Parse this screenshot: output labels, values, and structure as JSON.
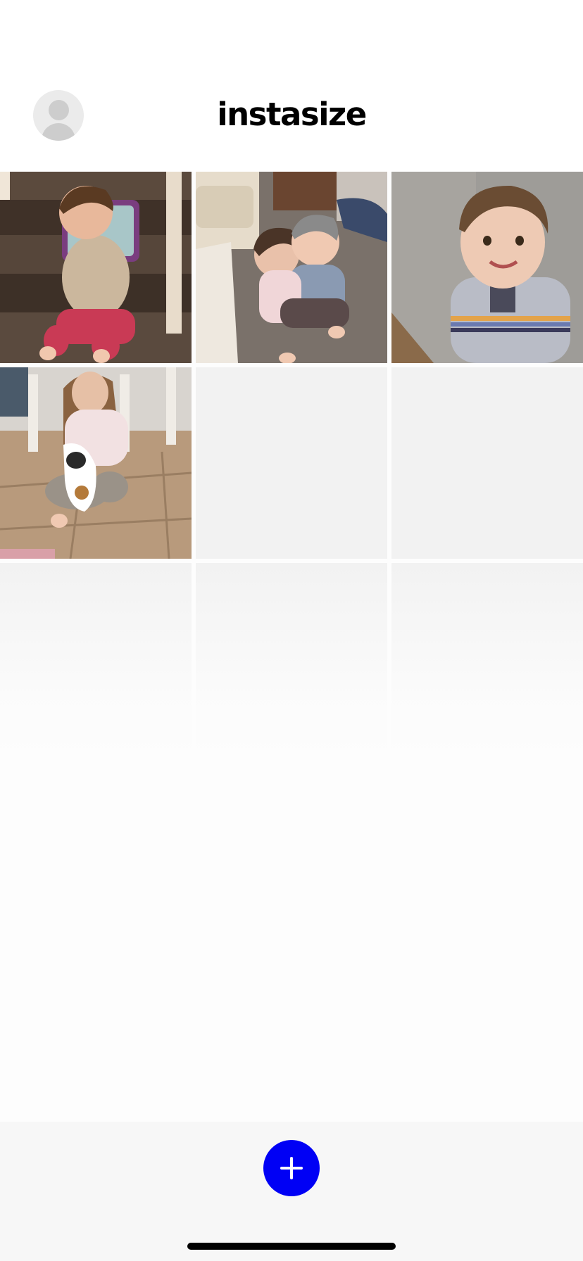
{
  "header": {
    "app_title": "instasize",
    "avatar_icon": "user-avatar-icon"
  },
  "grid": {
    "cells": [
      {
        "type": "photo",
        "description_icon": "photo-thumbnail"
      },
      {
        "type": "photo",
        "description_icon": "photo-thumbnail"
      },
      {
        "type": "photo",
        "description_icon": "photo-thumbnail"
      },
      {
        "type": "photo",
        "description_icon": "photo-thumbnail"
      },
      {
        "type": "empty"
      },
      {
        "type": "empty"
      },
      {
        "type": "empty"
      },
      {
        "type": "empty"
      },
      {
        "type": "empty"
      }
    ]
  },
  "bottom": {
    "add_icon": "plus-icon"
  },
  "colors": {
    "accent": "#0000f5",
    "placeholder": "#f2f2f2",
    "bottom_bar": "#f7f7f7"
  }
}
